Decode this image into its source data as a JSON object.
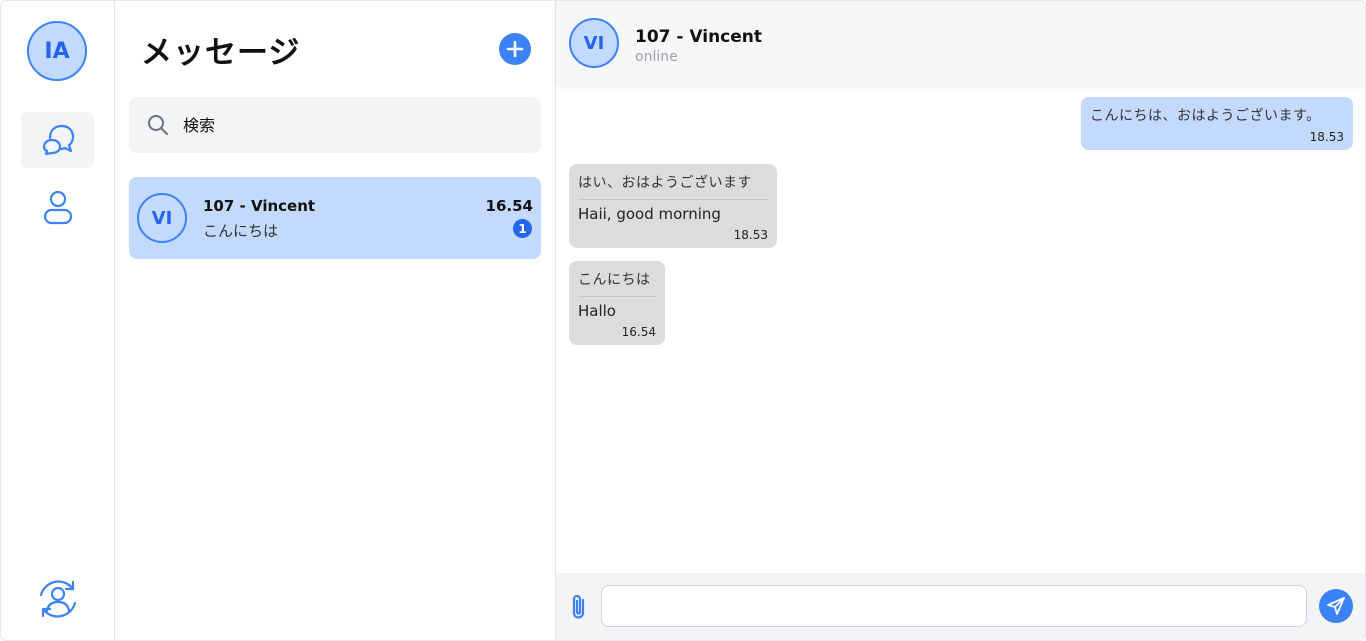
{
  "rail": {
    "user_initials": "IA",
    "items": [
      {
        "icon": "chat-bubbles-icon",
        "active": true
      },
      {
        "icon": "user-icon",
        "active": false
      },
      {
        "icon": "switch-account-icon",
        "active": false
      }
    ]
  },
  "list": {
    "title": "メッセージ",
    "new_button_icon": "plus-icon",
    "search": {
      "placeholder": "検索",
      "icon": "search-icon"
    },
    "conversations": [
      {
        "initials": "VI",
        "name": "107 - Vincent",
        "preview": "こんにちは",
        "time": "16.54",
        "unread": "1"
      }
    ]
  },
  "chat": {
    "header": {
      "initials": "VI",
      "name": "107 - Vincent",
      "status": "online"
    },
    "messages": [
      {
        "direction": "out",
        "text": "こんにちは、おはようございます。",
        "time": "18.53"
      },
      {
        "direction": "in",
        "text": "はい、おはようございます",
        "translation": "Haii, good morning",
        "time": "18.53"
      },
      {
        "direction": "in",
        "text": "こんにちは",
        "translation": "Hallo",
        "time": "16.54"
      }
    ],
    "composer": {
      "value": "",
      "attach_icon": "paperclip-icon",
      "send_icon": "send-icon"
    }
  },
  "colors": {
    "accent": "#3b82f6",
    "selected": "#c3dafe",
    "incoming_bubble": "#dcdcdc"
  }
}
